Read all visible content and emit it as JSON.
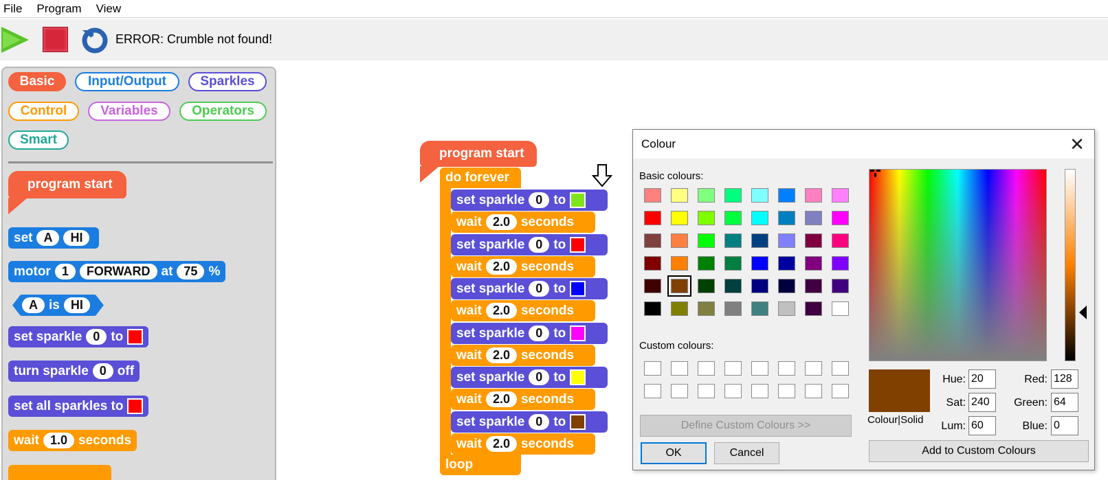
{
  "menu": {
    "file": "File",
    "program": "Program",
    "view": "View"
  },
  "toolbar": {
    "status": "ERROR: Crumble not found!"
  },
  "palette": {
    "categories": {
      "basic": "Basic",
      "input_output": "Input/Output",
      "sparkles": "Sparkles",
      "control": "Control",
      "variables": "Variables",
      "operators": "Operators",
      "smart": "Smart"
    },
    "blocks": {
      "program_start": "program start",
      "set": "set",
      "set_a": "A",
      "set_hi": "HI",
      "motor": "motor",
      "motor_num": "1",
      "motor_dir": "FORWARD",
      "motor_at": "at",
      "motor_pct_val": "75",
      "motor_pct": "%",
      "is_a": "A",
      "is": "is",
      "is_hi": "HI",
      "set_sparkle": "set sparkle",
      "set_sparkle_num": "0",
      "set_sparkle_to": "to",
      "turn_sparkle": "turn sparkle",
      "turn_sparkle_num": "0",
      "turn_sparkle_off": "off",
      "set_all": "set all sparkles to",
      "wait": "wait",
      "wait_val": "1.0",
      "wait_seconds": "seconds"
    }
  },
  "program": {
    "start": "program start",
    "do_forever": "do forever",
    "loop": "loop",
    "set_sparkle": "set sparkle",
    "sparkle_num": "0",
    "to": "to",
    "wait": "wait",
    "wait_val": "2.0",
    "seconds": "seconds",
    "colors": [
      "#7fe51a",
      "#ff0000",
      "#0000ff",
      "#ff00ff",
      "#ffff00",
      "#804000"
    ]
  },
  "dialog": {
    "title": "Colour",
    "basic_colours": "Basic colours:",
    "custom_colours": "Custom colours:",
    "define_custom": "Define Custom Colours >>",
    "ok": "OK",
    "cancel": "Cancel",
    "add_custom": "Add to Custom Colours",
    "colour_solid": "Colour|Solid",
    "hue_label": "Hue:",
    "hue": "20",
    "sat_label": "Sat:",
    "sat": "240",
    "lum_label": "Lum:",
    "lum": "60",
    "red_label": "Red:",
    "red": "128",
    "green_label": "Green:",
    "green": "64",
    "blue_label": "Blue:",
    "blue": "0",
    "basic_swatches": [
      [
        "#ff8080",
        "#ffff80",
        "#80ff80",
        "#00ff80",
        "#80ffff",
        "#0080ff",
        "#ff80c0",
        "#ff80ff"
      ],
      [
        "#ff0000",
        "#ffff00",
        "#80ff00",
        "#00ff40",
        "#00ffff",
        "#0080c0",
        "#8080c0",
        "#ff00ff"
      ],
      [
        "#804040",
        "#ff8040",
        "#00ff00",
        "#008080",
        "#004080",
        "#8080ff",
        "#800040",
        "#ff0080"
      ],
      [
        "#800000",
        "#ff8000",
        "#008000",
        "#008040",
        "#0000ff",
        "#0000a0",
        "#800080",
        "#8000ff"
      ],
      [
        "#400000",
        "#804000",
        "#004000",
        "#004040",
        "#000080",
        "#000040",
        "#400040",
        "#400080"
      ],
      [
        "#000000",
        "#808000",
        "#808040",
        "#808080",
        "#408080",
        "#c0c0c0",
        "#400040",
        "#ffffff"
      ]
    ]
  }
}
